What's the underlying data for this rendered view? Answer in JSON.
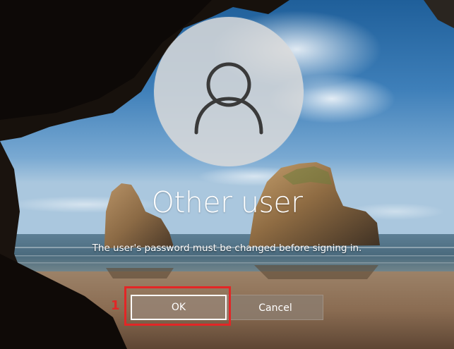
{
  "login": {
    "user_name": "Other user",
    "avatar_icon": "user-silhouette-icon",
    "message": "The user's password must be changed before signing in."
  },
  "buttons": {
    "ok_label": "OK",
    "cancel_label": "Cancel"
  },
  "annotation": {
    "step_number": "1",
    "color": "#e32626"
  },
  "colors": {
    "text": "#ffffff",
    "button_fill": "#8c7c6e",
    "avatar_fill": "#dadada",
    "avatar_icon": "#3a3a3a"
  }
}
